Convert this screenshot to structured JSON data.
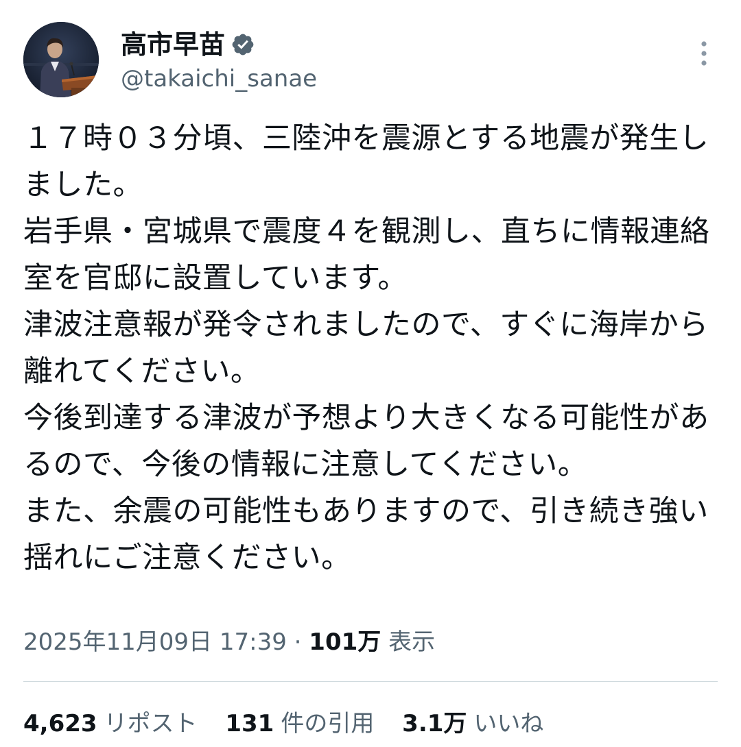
{
  "author": {
    "display_name": "高市早苗",
    "handle": "@takaichi_sanae",
    "verified_icon": "verified-badge-icon",
    "avatar_icon": "profile-photo"
  },
  "more_icon": "more-options-icon",
  "tweet": {
    "text": "１７時０３分頃、三陸沖を震源とする地震が発生しました。\n岩手県・宮城県で震度４を観測し、直ちに情報連絡室を官邸に設置しています。\n津波注意報が発令されましたので、すぐに海岸から離れてください。\n今後到達する津波が予想より大きくなる可能性があるので、今後の情報に注意してください。\nまた、余震の可能性もありますので、引き続き強い揺れにご注意ください。"
  },
  "meta": {
    "datetime": "2025年11月09日 17:39",
    "separator": "·",
    "views_count": "101万",
    "views_label": "表示"
  },
  "stats": {
    "reposts_count": "4,623",
    "reposts_label": "リポスト",
    "quotes_count": "131",
    "quotes_label": "件の引用",
    "likes_count": "3.1万",
    "likes_label": "いいね"
  },
  "colors": {
    "text": "#0f1419",
    "secondary": "#536471",
    "divider": "#cfd9de",
    "verified": "#536471"
  }
}
